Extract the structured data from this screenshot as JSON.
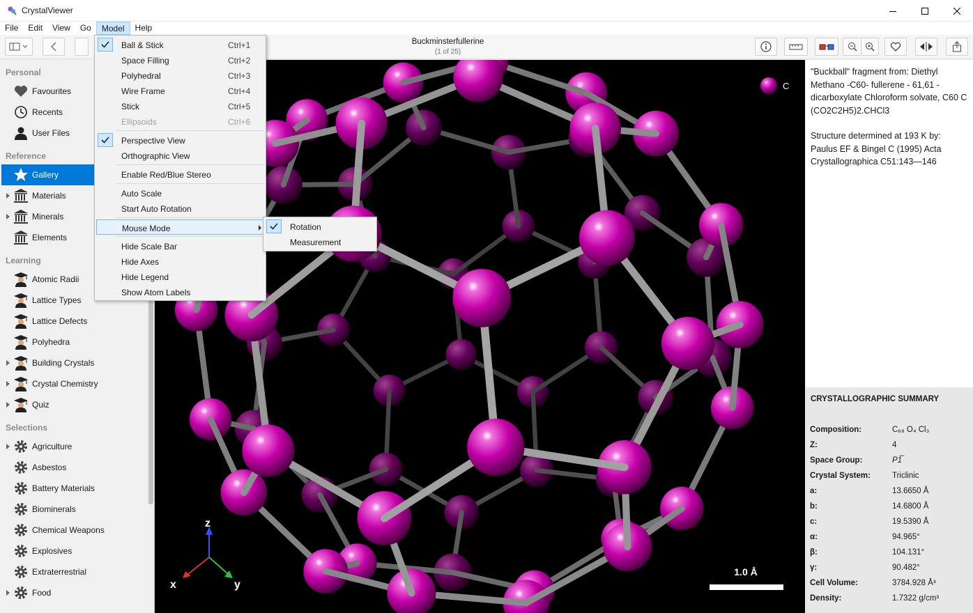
{
  "app": {
    "title": "CrystalViewer"
  },
  "menubar": [
    "File",
    "Edit",
    "View",
    "Go",
    "Model",
    "Help"
  ],
  "toolbar": {
    "doc_title": "Buckminsterfullerine",
    "doc_counter": "(1 of 25)"
  },
  "sidebar": {
    "sections": [
      {
        "header": "Personal",
        "items": [
          {
            "label": "Favourites",
            "icon": "heart-icon"
          },
          {
            "label": "Recents",
            "icon": "clock-icon"
          },
          {
            "label": "User Files",
            "icon": "user-icon"
          }
        ]
      },
      {
        "header": "Reference",
        "items": [
          {
            "label": "Gallery",
            "icon": "star-icon",
            "selected": true
          },
          {
            "label": "Materials",
            "icon": "building-icon",
            "expandable": true
          },
          {
            "label": "Minerals",
            "icon": "building-icon",
            "expandable": true
          },
          {
            "label": "Elements",
            "icon": "building-icon"
          }
        ]
      },
      {
        "header": "Learning",
        "items": [
          {
            "label": "Atomic Radii",
            "icon": "graduate-icon"
          },
          {
            "label": "Lattice Types",
            "icon": "graduate-icon"
          },
          {
            "label": "Lattice Defects",
            "icon": "graduate-icon"
          },
          {
            "label": "Polyhedra",
            "icon": "graduate-icon"
          },
          {
            "label": "Building Crystals",
            "icon": "graduate-icon",
            "expandable": true
          },
          {
            "label": "Crystal Chemistry",
            "icon": "graduate-icon",
            "expandable": true
          },
          {
            "label": "Quiz",
            "icon": "graduate-icon",
            "expandable": true
          }
        ]
      },
      {
        "header": "Selections",
        "items": [
          {
            "label": "Agriculture",
            "icon": "gear-icon",
            "expandable": true
          },
          {
            "label": "Asbestos",
            "icon": "gear-icon"
          },
          {
            "label": "Battery Materials",
            "icon": "gear-icon"
          },
          {
            "label": "Biominerals",
            "icon": "gear-icon"
          },
          {
            "label": "Chemical Weapons",
            "icon": "gear-icon"
          },
          {
            "label": "Explosives",
            "icon": "gear-icon"
          },
          {
            "label": "Extraterrestrial",
            "icon": "gear-icon"
          },
          {
            "label": "Food",
            "icon": "gear-icon",
            "expandable": true
          }
        ]
      }
    ]
  },
  "model_menu": {
    "items": [
      {
        "label": "Ball & Stick",
        "shortcut": "Ctrl+1",
        "checked": true
      },
      {
        "label": "Space Filling",
        "shortcut": "Ctrl+2"
      },
      {
        "label": "Polyhedral",
        "shortcut": "Ctrl+3"
      },
      {
        "label": "Wire Frame",
        "shortcut": "Ctrl+4"
      },
      {
        "label": "Stick",
        "shortcut": "Ctrl+5"
      },
      {
        "label": "Ellipsoids",
        "shortcut": "Ctrl+6",
        "disabled": true
      },
      {
        "separator": true
      },
      {
        "label": "Perspective View",
        "checked": true
      },
      {
        "label": "Orthographic View"
      },
      {
        "separator": true
      },
      {
        "label": "Enable Red/Blue Stereo"
      },
      {
        "separator": true
      },
      {
        "label": "Auto Scale"
      },
      {
        "label": "Start Auto Rotation"
      },
      {
        "separator": true
      },
      {
        "label": "Mouse Mode",
        "submenu": true,
        "highlighted": true
      },
      {
        "separator": true
      },
      {
        "label": "Hide Scale Bar"
      },
      {
        "label": "Hide Axes"
      },
      {
        "label": "Hide Legend"
      },
      {
        "label": "Show Atom Labels"
      }
    ],
    "mouse_mode_submenu": [
      {
        "label": "Rotation",
        "checked": true
      },
      {
        "label": "Measurement"
      }
    ]
  },
  "viewport": {
    "legend_element": "C",
    "atom_color": "#d400b4",
    "scale_bar_label": "1.0 Å",
    "axis_labels": {
      "x": "x",
      "y": "y",
      "z": "z"
    }
  },
  "info": {
    "description": "\"Buckball\" fragment from: Diethyl Methano -C60- fullerene - 61,61 - dicarboxylate Chloroform solvate, C60 C (CO2C2H5)2.CHCl3",
    "structure_note": "Structure determined at 193 K by: Paulus EF & Bingel C (1995) Acta Crystallographica C51:143—146"
  },
  "summary": {
    "header": "CRYSTALLOGRAPHIC SUMMARY",
    "rows": [
      {
        "key": "Composition:",
        "value": "C₆₈ O₄ Cl₃"
      },
      {
        "key": "Z:",
        "value": "4"
      },
      {
        "key": "Space Group:",
        "value": "P1̅"
      },
      {
        "key": "Crystal System:",
        "value": "Triclinic"
      },
      {
        "key": "a:",
        "value": "13.6650 Å"
      },
      {
        "key": "b:",
        "value": "14.6800 Å"
      },
      {
        "key": "c:",
        "value": "19.5390 Å"
      },
      {
        "key": "α:",
        "value": "94.965°"
      },
      {
        "key": "β:",
        "value": "104.131°"
      },
      {
        "key": "γ:",
        "value": "90.482°"
      },
      {
        "key": "Cell Volume:",
        "value": "3784.928 Å³"
      },
      {
        "key": "Density:",
        "value": "1.7322 g/cm³"
      }
    ]
  }
}
